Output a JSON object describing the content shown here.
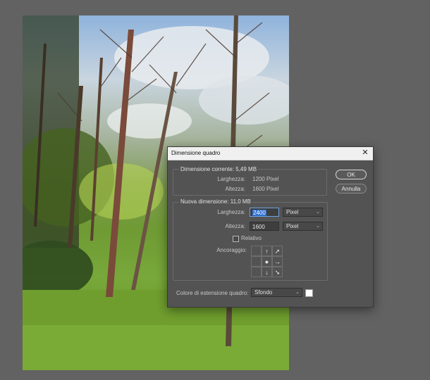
{
  "dialog": {
    "title": "Dimensione quadro",
    "close_icon": "close-icon",
    "current": {
      "heading": "Dimensione corrente: 5,49 MB",
      "width_label": "Larghezza:",
      "width_value": "1200 Pixel",
      "height_label": "Altezza:",
      "height_value": "1600 Pixel"
    },
    "new": {
      "heading": "Nuova dimensione: 11,0 MB",
      "width_label": "Larghezza:",
      "width_value": "2400",
      "width_unit": "Pixel",
      "height_label": "Altezza:",
      "height_value": "1600",
      "height_unit": "Pixel",
      "relative_label": "Relativo",
      "relative_checked": false,
      "anchor_label": "Ancoraggio:",
      "anchor_icons": [
        "arrow-up-left-icon",
        "arrow-up-icon",
        "arrow-up-right-icon",
        "arrow-left-icon",
        "anchor-dot-icon",
        "arrow-right-icon",
        "arrow-down-left-icon",
        "arrow-down-icon",
        "arrow-down-right-icon"
      ],
      "anchor_glyphs": [
        "",
        "↑",
        "➚",
        "",
        "●",
        "→",
        "",
        "↓",
        "➘"
      ]
    },
    "extension": {
      "label": "Colore di estensione quadro:",
      "value": "Sfondo",
      "swatch_color": "#ffffff"
    },
    "ok_label": "OK",
    "cancel_label": "Annulla"
  }
}
